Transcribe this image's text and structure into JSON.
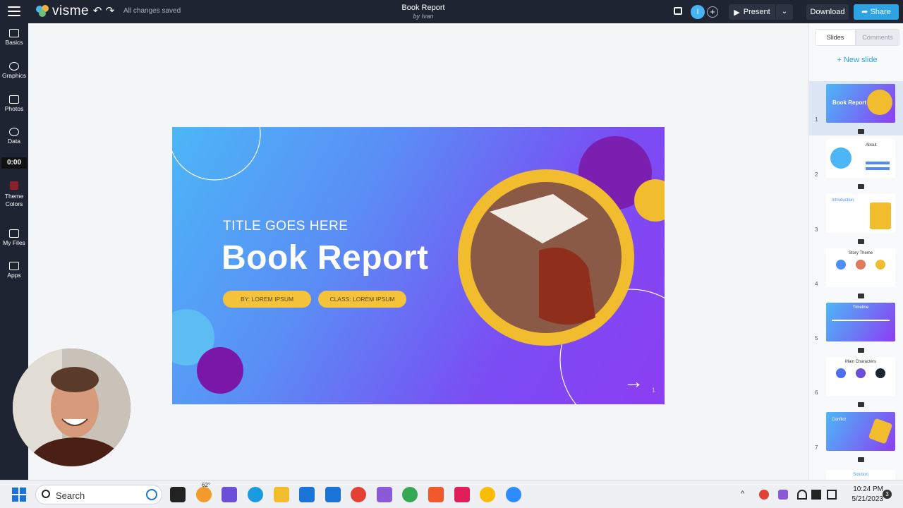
{
  "topbar": {
    "logo_text": "visme",
    "save_status": "All changes saved",
    "doc_title": "Book Report",
    "doc_author": "by Ivan",
    "avatar_initial": "I",
    "present_label": "Present",
    "download_label": "Download",
    "share_label": "Share"
  },
  "lefttool": {
    "items": [
      {
        "label": "Basics"
      },
      {
        "label": "Graphics"
      },
      {
        "label": "Photos"
      },
      {
        "label": "Data"
      },
      {
        "label": "Theme Colors"
      },
      {
        "label": "My Files"
      },
      {
        "label": "Apps"
      }
    ],
    "timer": "0:00"
  },
  "slide": {
    "subtitle": "TITLE GOES HERE",
    "title": "Book Report",
    "pill1": "BY: LOREM IPSUM",
    "pill2": "CLASS: LOREM IPSUM",
    "page_number": "1",
    "colors": {
      "gradient_start": "#4cb6f7",
      "gradient_end": "#8c3ef2",
      "accent": "#f5c33b",
      "sphere": "#7a1fb0"
    }
  },
  "rightpanel": {
    "tab_slides": "Slides",
    "tab_comments": "Comments",
    "new_slide": "+ New slide",
    "thumbs": [
      {
        "num": "1",
        "title": "Book Report"
      },
      {
        "num": "2",
        "title": "About"
      },
      {
        "num": "3",
        "title": "Introduction"
      },
      {
        "num": "4",
        "title": "Story Theme"
      },
      {
        "num": "5",
        "title": "Timeline"
      },
      {
        "num": "6",
        "title": "Main Characters"
      },
      {
        "num": "7",
        "title": "Conflict"
      },
      {
        "num": "",
        "title": "Solution"
      }
    ]
  },
  "taskbar": {
    "search_placeholder": "Search",
    "weather": "62°",
    "time": "10:24 PM",
    "date": "5/21/2023",
    "notifications": "3"
  }
}
